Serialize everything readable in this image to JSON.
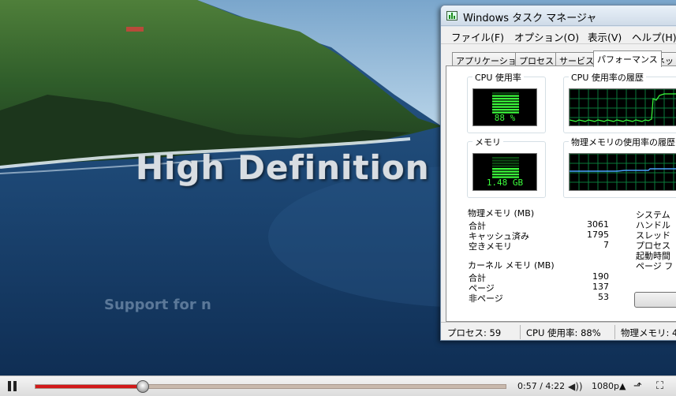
{
  "video": {
    "title_text": "High Definition V",
    "subtitle_text": "Support for n"
  },
  "player": {
    "progress_fraction": 0.2283,
    "time": "0:57 / 4:22",
    "quality": "1080p"
  },
  "taskmgr": {
    "window_title": "Windows タスク マネージャ",
    "menu": [
      "ファイル(F)",
      "オプション(O)",
      "表示(V)",
      "ヘルプ(H)"
    ],
    "tabs": [
      "アプリケーション",
      "プロセス",
      "サービス",
      "パフォーマンス",
      "ネット"
    ],
    "active_tab_index": 3,
    "cpu_group_label": "CPU 使用率",
    "cpu_value": "88 %",
    "cpu_level": 0.88,
    "cpu_history_label": "CPU 使用率の履歴",
    "mem_group_label": "メモリ",
    "mem_value": "1.48 GB",
    "mem_history_label": "物理メモリの使用率の履歴",
    "phys": {
      "label": "物理メモリ (MB)",
      "rows": [
        {
          "k": "合計",
          "v": "3061"
        },
        {
          "k": "キャッシュ済み",
          "v": "1795"
        },
        {
          "k": "空きメモリ",
          "v": "7"
        }
      ]
    },
    "kernel": {
      "label": "カーネル メモリ (MB)",
      "rows": [
        {
          "k": "合計",
          "v": "190"
        },
        {
          "k": "ページ",
          "v": "137"
        },
        {
          "k": "非ページ",
          "v": "53"
        }
      ]
    },
    "system": {
      "label": "システム",
      "rows": [
        "ハンドル",
        "スレッド",
        "プロセス",
        "起動時間",
        "ページ フ"
      ]
    },
    "status": {
      "processes": "プロセス: 59",
      "cpu": "CPU 使用率: 88%",
      "mem": "物理メモリ: 4"
    },
    "colors": {
      "meter_green": "#3cff3c",
      "graph_grid": "#0a7a3a",
      "cpu_line": "#3cff3c",
      "mem_line": "#4aa3ff"
    }
  }
}
